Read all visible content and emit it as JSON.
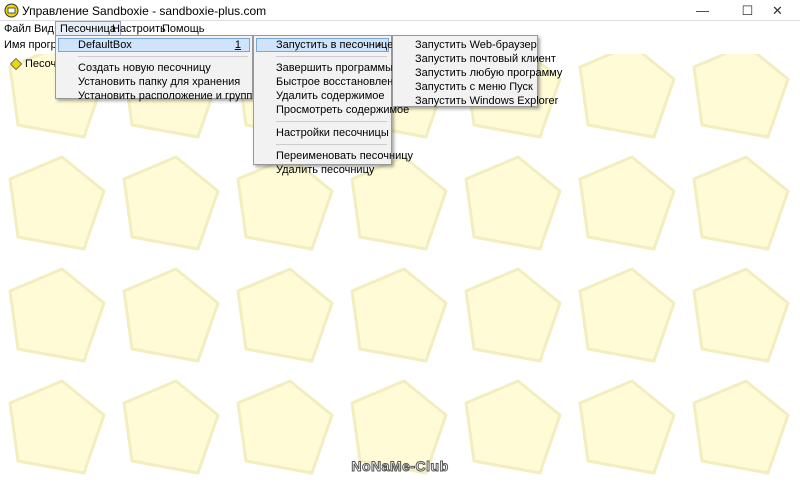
{
  "window": {
    "title": "Управление Sandboxie - sandboxie-plus.com",
    "minimize_glyph": "—",
    "maximize_glyph": "☐",
    "close_glyph": "✕"
  },
  "menubar": {
    "items": [
      "Файл",
      "Вид",
      "Песочница",
      "Настроить",
      "Помощь"
    ]
  },
  "content": {
    "column_header": "Имя програм",
    "tree_item": "Песочни"
  },
  "menu_sandbox": {
    "default_box": "DefaultBox",
    "default_box_shortcut": "1",
    "create_new": "Создать новую песочницу",
    "set_storage_folder": "Установить папку для хранения",
    "set_location_groups": "Установить расположение и группы"
  },
  "menu_box": {
    "run_in_sandbox": "Запустить в песочнице",
    "terminate_programs": "Завершить программы",
    "quick_recovery": "Быстрое восстановление",
    "delete_contents": "Удалить содержимое",
    "explore_contents": "Просмотреть содержимое",
    "sandbox_settings": "Настройки песочницы",
    "rename_sandbox": "Переименовать песочницу",
    "delete_sandbox": "Удалить песочницу"
  },
  "menu_run": {
    "web_browser": "Запустить Web-браузер",
    "mail_client": "Запустить почтовый клиент",
    "any_program": "Запустить любую программу",
    "start_menu": "Запустить с меню Пуск",
    "windows_explorer": "Запустить Windows Explorer"
  },
  "watermark": "NoNaMe-Club",
  "colors": {
    "pattern_fill": "#fffbd6",
    "pattern_stroke": "#f2eec0",
    "menu_bg": "#f2f2f2",
    "hover_bg": "#cfe3fa",
    "icon_yellow": "#f5d400"
  },
  "icons": {
    "app": "sandboxie-icon",
    "tree": "sandbox-box-icon",
    "submenu": "chevron-right-icon"
  }
}
